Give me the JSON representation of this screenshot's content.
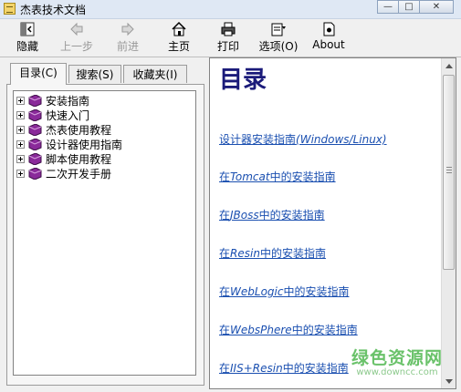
{
  "window": {
    "title": "杰表技术文档"
  },
  "toolbar": {
    "hide": "隐藏",
    "back": "上一步",
    "forward": "前进",
    "home": "主页",
    "print": "打印",
    "options": "选项(O)",
    "about": "About"
  },
  "tabs": [
    {
      "label": "目录(C)",
      "active": true
    },
    {
      "label": "搜索(S)",
      "active": false
    },
    {
      "label": "收藏夹(I)",
      "active": false
    }
  ],
  "tree": [
    {
      "label": "安装指南"
    },
    {
      "label": "快速入门"
    },
    {
      "label": "杰表使用教程"
    },
    {
      "label": "设计器使用指南"
    },
    {
      "label": "脚本使用教程"
    },
    {
      "label": "二次开发手册"
    }
  ],
  "content": {
    "heading": "目录",
    "links": [
      {
        "pre": "设计器安装指南",
        "it": "(Windows/Linux)",
        "post": ""
      },
      {
        "pre": "在",
        "it": "Tomcat",
        "post": "中的安装指南"
      },
      {
        "pre": "在",
        "it": "JBoss",
        "post": "中的安装指南"
      },
      {
        "pre": "在",
        "it": "Resin",
        "post": "中的安装指南"
      },
      {
        "pre": "在",
        "it": "WebLogic",
        "post": "中的安装指南"
      },
      {
        "pre": "在",
        "it": "WebsPhere",
        "post": "中的安装指南"
      },
      {
        "pre": "在",
        "it": "IIS+Resin",
        "post": "中的安装指南"
      }
    ]
  },
  "watermark": {
    "main": "绿色资源网",
    "sub": "www.downcc.com"
  },
  "colors": {
    "heading": "#1b1b7a",
    "link": "#1a4fb0",
    "book": "#8a2a9a"
  }
}
